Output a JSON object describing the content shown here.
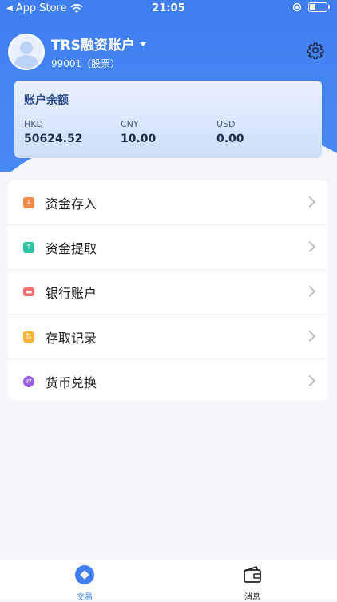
{
  "status_bar": {
    "back_app": "App Store",
    "time": "21:05",
    "battery_level": 0.4
  },
  "profile": {
    "name": "TRS融资账户",
    "subtitle": "99001（股票）"
  },
  "balance_card": {
    "title": "账户余额",
    "currencies": [
      {
        "code": "HKD",
        "amount": "50624.52"
      },
      {
        "code": "CNY",
        "amount": "10.00"
      },
      {
        "code": "USD",
        "amount": "0.00"
      }
    ]
  },
  "menu": {
    "items": [
      {
        "label": "资金存入",
        "icon": "deposit-icon",
        "color": "#f08a4b"
      },
      {
        "label": "资金提取",
        "icon": "withdraw-icon",
        "color": "#2fc3a3"
      },
      {
        "label": "银行账户",
        "icon": "bank-card-icon",
        "color": "#f06e6e"
      },
      {
        "label": "存取记录",
        "icon": "record-icon",
        "color": "#f5b53a"
      },
      {
        "label": "货币兑换",
        "icon": "exchange-icon",
        "color": "#9b5de5"
      }
    ]
  },
  "tabbar": {
    "tabs": [
      {
        "label": "交易",
        "icon": "trade-icon",
        "active": true
      },
      {
        "label": "消息",
        "icon": "wallet-icon",
        "active": false
      }
    ]
  },
  "colors": {
    "brand": "#3f7ef0",
    "active_tab": "#3f7ef0",
    "inactive_tab": "#222222"
  }
}
